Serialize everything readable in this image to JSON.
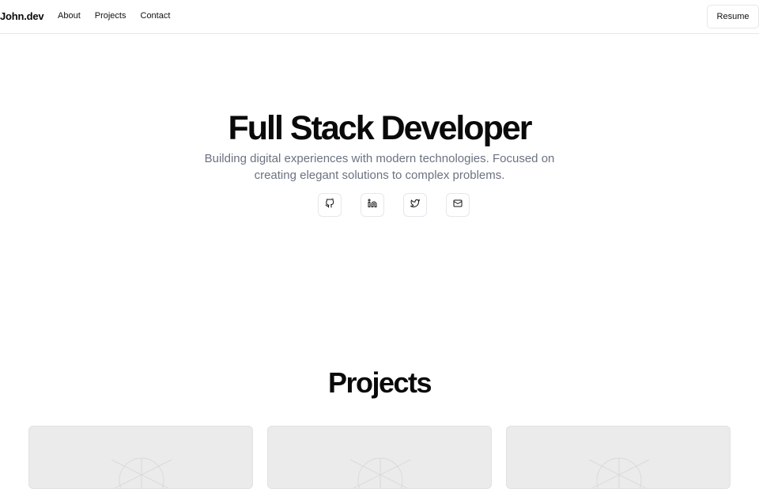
{
  "header": {
    "brand": "John.dev",
    "nav": [
      {
        "label": "About"
      },
      {
        "label": "Projects"
      },
      {
        "label": "Contact"
      }
    ],
    "resume_label": "Resume"
  },
  "hero": {
    "title": "Full Stack Developer",
    "subtitle": "Building digital experiences with modern technologies. Focused on creating elegant solutions to complex problems.",
    "socials": [
      {
        "icon": "github-icon"
      },
      {
        "icon": "linkedin-icon"
      },
      {
        "icon": "twitter-icon"
      },
      {
        "icon": "mail-icon"
      }
    ]
  },
  "projects": {
    "title": "Projects",
    "cards": [
      {
        "image": "placeholder-image"
      },
      {
        "image": "placeholder-image"
      },
      {
        "image": "placeholder-image"
      }
    ]
  }
}
